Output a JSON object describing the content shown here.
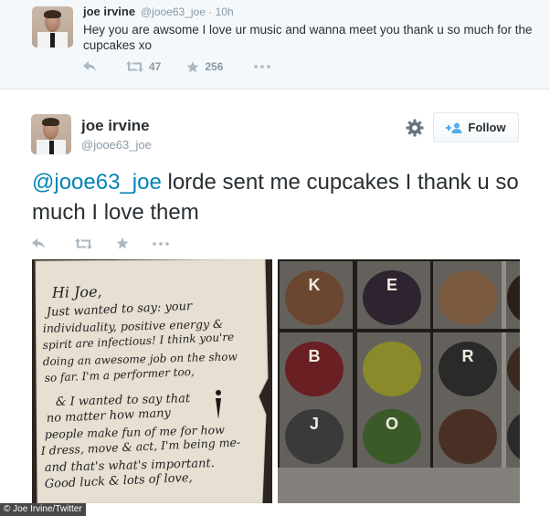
{
  "reply_tweet": {
    "name": "joe irvine",
    "handle": "@jooe63_joe",
    "separator": "·",
    "time": "10h",
    "text": "Hey you are awsome I love ur music and wanna meet you thank u so much for the cupcakes xo",
    "retweets": "47",
    "favorites": "256"
  },
  "main_tweet": {
    "name": "joe irvine",
    "handle": "@jooe63_joe",
    "follow_label": "Follow",
    "mention": "@jooe63_joe",
    "text": " lorde sent me cupcakes I thank u so much I love them"
  },
  "note_photo": {
    "lines": [
      "Hi Joe,",
      "Just wanted to say: your",
      "individuality, positive energy &",
      "spirit are infectious! I think you're",
      "doing an awesome job on the show",
      "so far. I'm a performer too,",
      "& I wanted to say that",
      "no matter how many",
      "people make fun of me for how",
      "I dress, move & act, I'm being me-",
      "and that's what's important.",
      "Good luck & lots of love,"
    ]
  },
  "cupcake_photo": {
    "letters": [
      "K",
      "E",
      "",
      "",
      "B",
      "",
      "R",
      "",
      "J",
      "O",
      "",
      ""
    ]
  },
  "credit": "© Joe Irvine/Twitter",
  "icons": [
    "reply-icon",
    "retweet-icon",
    "favorite-icon",
    "more-icon",
    "gear-icon",
    "follow-person-icon"
  ],
  "colors": {
    "link": "#0084b4",
    "muted": "#8899a6",
    "action": "#aab8c2"
  }
}
